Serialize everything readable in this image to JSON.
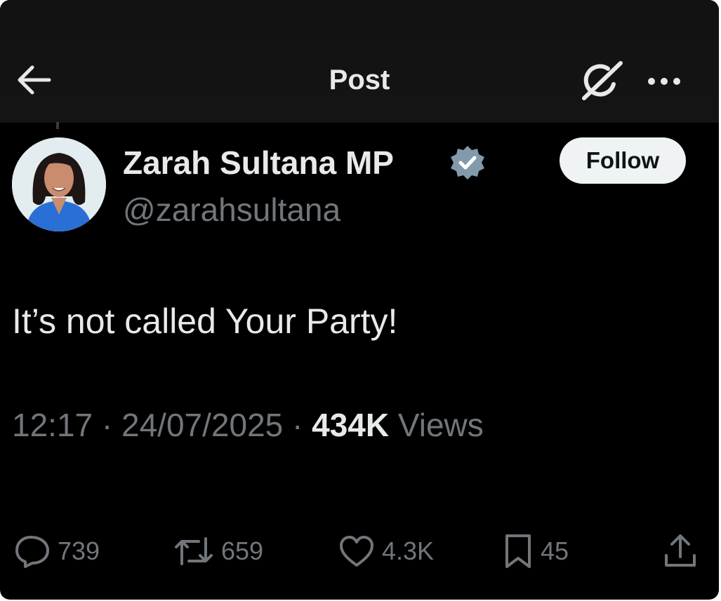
{
  "header": {
    "title": "Post",
    "back_icon": "arrow-left-icon",
    "grok_icon": "grok-icon",
    "more_icon": "more-horizontal-icon"
  },
  "author": {
    "name": "Zarah Sultana MP",
    "handle": "@zarahsultana",
    "verified": true,
    "verified_badge_color": "#829aab",
    "follow_label": "Follow"
  },
  "post": {
    "text": "It’s not called Your Party!",
    "time": "12:17",
    "date": "24/07/2025",
    "views_count": "434K",
    "views_label": "Views"
  },
  "actions": {
    "replies": "739",
    "reposts": "659",
    "likes": "4.3K",
    "bookmarks": "45"
  },
  "colors": {
    "background": "#000000",
    "text_primary": "#e7e9ea",
    "text_secondary": "#71767b",
    "follow_bg": "#eff3f4"
  }
}
